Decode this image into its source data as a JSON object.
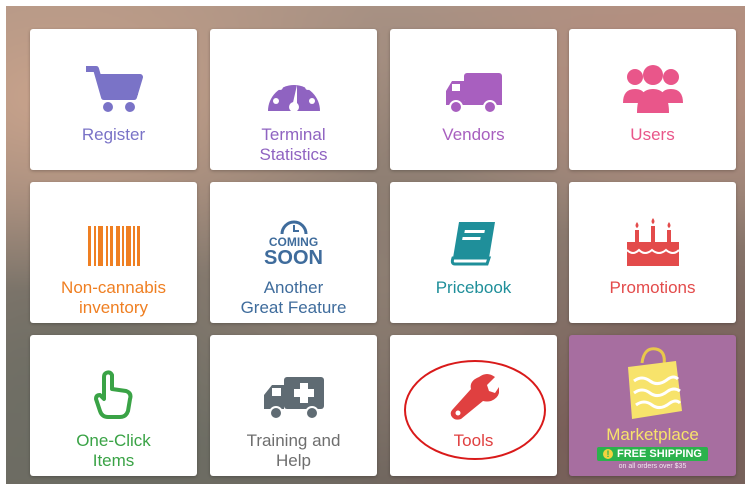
{
  "tiles": {
    "register": {
      "label": "Register",
      "color": "#7a73c7",
      "icon": "cart-icon"
    },
    "terminal_statistics": {
      "label": "Terminal\nStatistics",
      "color": "#8f63c1",
      "icon": "gauge-icon"
    },
    "vendors": {
      "label": "Vendors",
      "color": "#a85fbf",
      "icon": "truck-icon"
    },
    "users": {
      "label": "Users",
      "color": "#e9568a",
      "icon": "users-icon"
    },
    "non_cannabis": {
      "label": "Non-cannabis\ninventory",
      "color": "#ef7f22",
      "icon": "barcode-icon"
    },
    "another_feature": {
      "label": "Another\nGreat Feature",
      "color": "#3f6c9c",
      "icon": "coming-soon-icon",
      "badge_top": "COMING",
      "badge_bottom": "SOON"
    },
    "pricebook": {
      "label": "Pricebook",
      "color": "#1f8f9a",
      "icon": "book-icon"
    },
    "promotions": {
      "label": "Promotions",
      "color": "#e34b4b",
      "icon": "cake-icon"
    },
    "one_click": {
      "label": "One-Click\nItems",
      "color": "#3aa346",
      "icon": "hand-pointer-icon"
    },
    "training": {
      "label": "Training and\nHelp",
      "color": "#6e6e6e",
      "icon": "ambulance-icon"
    },
    "tools": {
      "label": "Tools",
      "color": "#e04040",
      "icon": "wrench-icon"
    },
    "marketplace": {
      "label": "Marketplace",
      "shipping": "FREE SHIPPING",
      "fine_print": "on all orders over $35",
      "color": "#a76ea0",
      "accent": "#f7e36b",
      "icon": "shopping-bag-icon"
    }
  },
  "highlight_color": "#d91a1a"
}
